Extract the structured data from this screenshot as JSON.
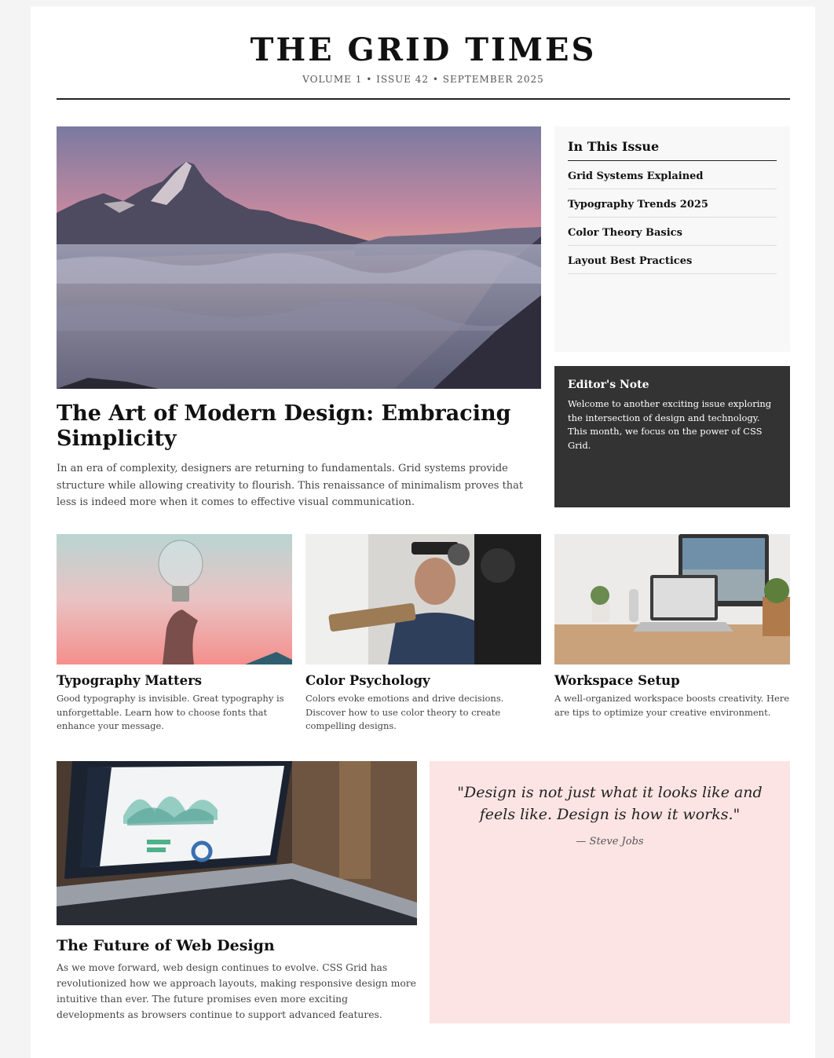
{
  "masthead": {
    "title": "THE GRID TIMES",
    "issue": "VOLUME 1 • ISSUE 42 • SEPTEMBER 2025"
  },
  "hero": {
    "image": "mountain-sunrise-above-clouds",
    "title": "The Art of Modern Design: Embracing Simplicity",
    "body": "In an era of complexity, designers are returning to fundamentals. Grid systems provide structure while allowing creativity to flourish. This renaissance of minimalism proves that less is indeed more when it comes to effective visual communication."
  },
  "toc": {
    "heading": "In This Issue",
    "items": [
      "Grid Systems Explained",
      "Typography Trends 2025",
      "Color Theory Basics",
      "Layout Best Practices"
    ]
  },
  "editor": {
    "heading": "Editor's Note",
    "body": "Welcome to another exciting issue exploring the intersection of design and technology. This month, we focus on the power of CSS Grid."
  },
  "cards": [
    {
      "image": "light-bulb-in-hand",
      "title": "Typography Matters",
      "body": "Good typography is invisible. Great typography is unforgettable. Learn how to choose fonts that enhance your message."
    },
    {
      "image": "man-with-soldering-tools",
      "title": "Color Psychology",
      "body": "Colors evoke emotions and drive decisions. Discover how to use color theory to create compelling designs."
    },
    {
      "image": "desk-workspace-with-laptop",
      "title": "Workspace Setup",
      "body": "A well-organized workspace boosts creativity. Here are tips to optimize your creative environment."
    }
  ],
  "future": {
    "image": "laptop-analytics-dashboard",
    "title": "The Future of Web Design",
    "body": "As we move forward, web design continues to evolve. CSS Grid has revolutionized how we approach layouts, making responsive design more intuitive than ever. The future promises even more exciting developments as browsers continue to support advanced features."
  },
  "quote": {
    "text": "\"Design is not just what it looks like and feels like. Design is how it works.\"",
    "author": "— Steve Jobs"
  },
  "colors": {
    "page_bg": "#f4f4f4",
    "sidebar_bg": "#f8f8f8",
    "editor_bg": "#333333",
    "quote_bg": "#fde4e4"
  }
}
